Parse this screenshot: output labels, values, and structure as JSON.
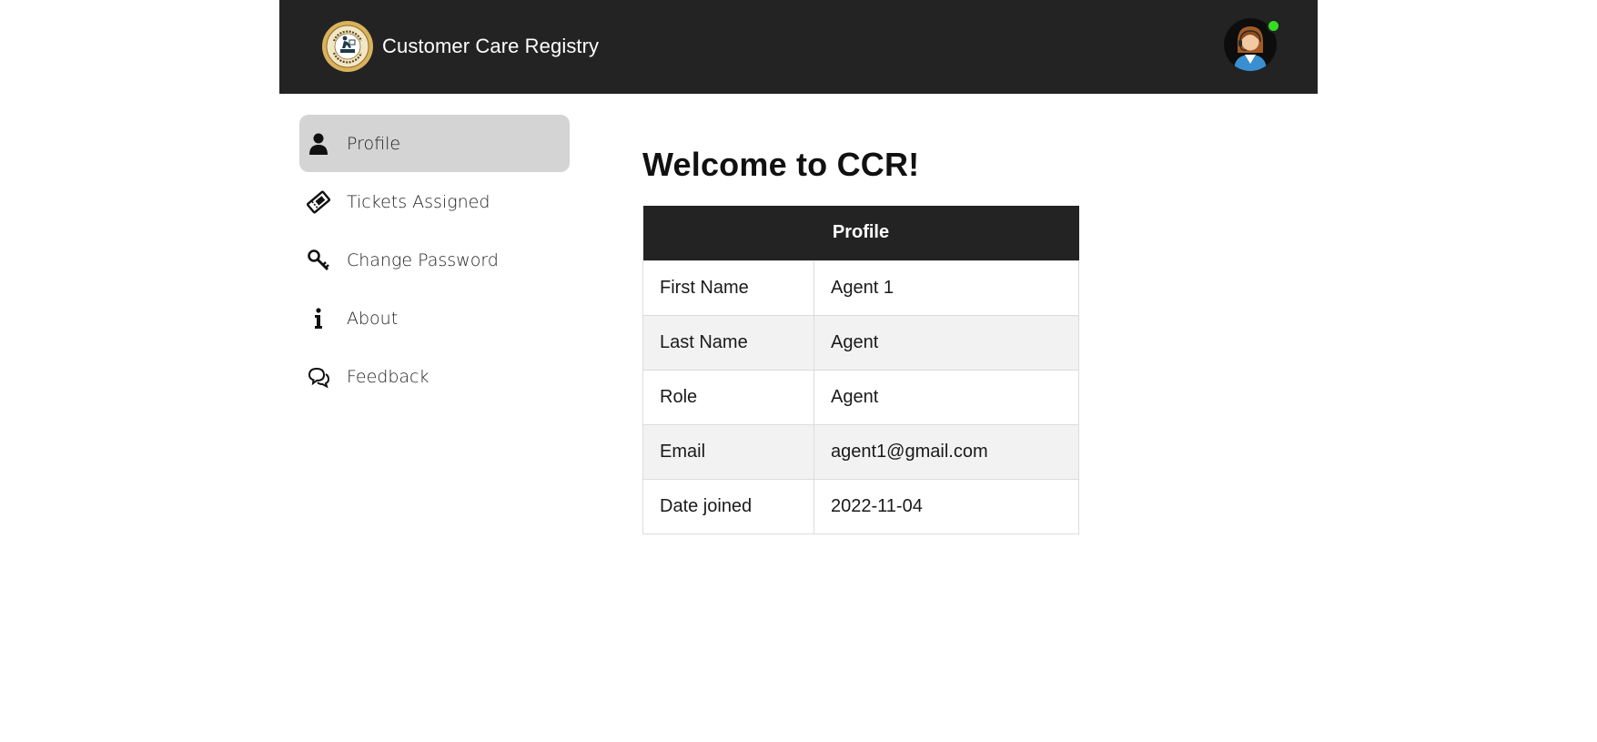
{
  "header": {
    "title": "Customer Care Registry",
    "logo_icon": "customer-care-registry-logo",
    "avatar_icon": "support-agent-avatar",
    "online_status_color": "#33dd22"
  },
  "sidebar": {
    "items": [
      {
        "label": "Profile",
        "icon": "user-icon",
        "active": true
      },
      {
        "label": "Tickets Assigned",
        "icon": "ticket-icon",
        "active": false
      },
      {
        "label": "Change Password",
        "icon": "key-icon",
        "active": false
      },
      {
        "label": "About",
        "icon": "info-icon",
        "active": false
      },
      {
        "label": "Feedback",
        "icon": "chat-bubbles-icon",
        "active": false
      }
    ]
  },
  "main": {
    "welcome": "Welcome to CCR!",
    "profile_table": {
      "header": "Profile",
      "rows": [
        {
          "key": "First Name",
          "value": "Agent 1"
        },
        {
          "key": "Last Name",
          "value": "Agent"
        },
        {
          "key": "Role",
          "value": "Agent"
        },
        {
          "key": "Email",
          "value": "agent1@gmail.com"
        },
        {
          "key": "Date joined",
          "value": "2022-11-04"
        }
      ]
    }
  },
  "colors": {
    "header_bg": "#232323",
    "active_nav_bg": "#d4d4d4",
    "alt_row_bg": "#f2f2f2"
  }
}
